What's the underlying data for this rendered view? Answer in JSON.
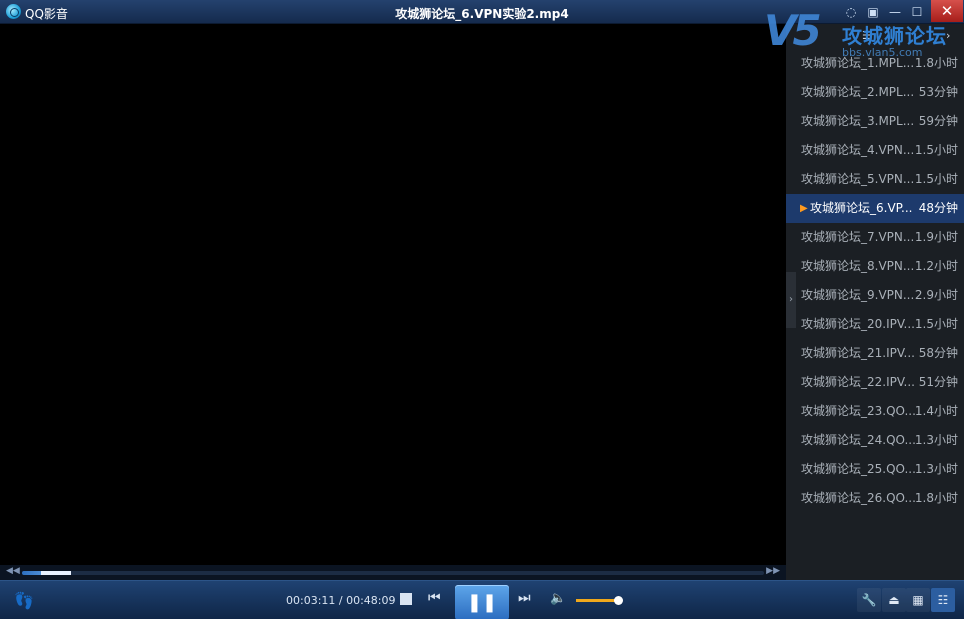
{
  "app": {
    "name": "QQ影音",
    "window_title": "攻城狮论坛_6.VPN实验2.mp4"
  },
  "titlebar_buttons": {
    "skin": "◌",
    "mini": "▣",
    "minimize": "—",
    "maximize": "☐",
    "close": "✕"
  },
  "watermark": {
    "big": "V5",
    "cn": "攻城狮论坛",
    "url": "bbs.vlan5.com"
  },
  "playlist": {
    "header_icons": [
      "list-icon",
      "collapse-icon"
    ],
    "items": [
      {
        "name": "攻城狮论坛_1.MPL...",
        "duration": "1.8小时",
        "active": false
      },
      {
        "name": "攻城狮论坛_2.MPL...",
        "duration": "53分钟",
        "active": false
      },
      {
        "name": "攻城狮论坛_3.MPL...",
        "duration": "59分钟",
        "active": false
      },
      {
        "name": "攻城狮论坛_4.VPN...",
        "duration": "1.5小时",
        "active": false
      },
      {
        "name": "攻城狮论坛_5.VPN...",
        "duration": "1.5小时",
        "active": false
      },
      {
        "name": "攻城狮论坛_6.VP...",
        "duration": "48分钟",
        "active": true
      },
      {
        "name": "攻城狮论坛_7.VPN...",
        "duration": "1.9小时",
        "active": false
      },
      {
        "name": "攻城狮论坛_8.VPN...",
        "duration": "1.2小时",
        "active": false
      },
      {
        "name": "攻城狮论坛_9.VPN...",
        "duration": "2.9小时",
        "active": false
      },
      {
        "name": "攻城狮论坛_20.IPV...",
        "duration": "1.5小时",
        "active": false
      },
      {
        "name": "攻城狮论坛_21.IPV...",
        "duration": "58分钟",
        "active": false
      },
      {
        "name": "攻城狮论坛_22.IPV...",
        "duration": "51分钟",
        "active": false
      },
      {
        "name": "攻城狮论坛_23.QO...",
        "duration": "1.4小时",
        "active": false
      },
      {
        "name": "攻城狮论坛_24.QO...",
        "duration": "1.3小时",
        "active": false
      },
      {
        "name": "攻城狮论坛_25.QO...",
        "duration": "1.3小时",
        "active": false
      },
      {
        "name": "攻城狮论坛_26.QO...",
        "duration": "1.8小时",
        "active": false
      }
    ]
  },
  "player": {
    "current_time": "00:03:11",
    "total_time": "00:48:09",
    "time_display": "00:03:11 / 00:48:09",
    "progress_fraction": 0.066,
    "volume_fraction": 0.95,
    "state": "playing"
  },
  "colors": {
    "accent": "#2b6cbf",
    "volume": "#f0a81c",
    "active_row": "#1d3a6c",
    "close": "#c0332d"
  }
}
